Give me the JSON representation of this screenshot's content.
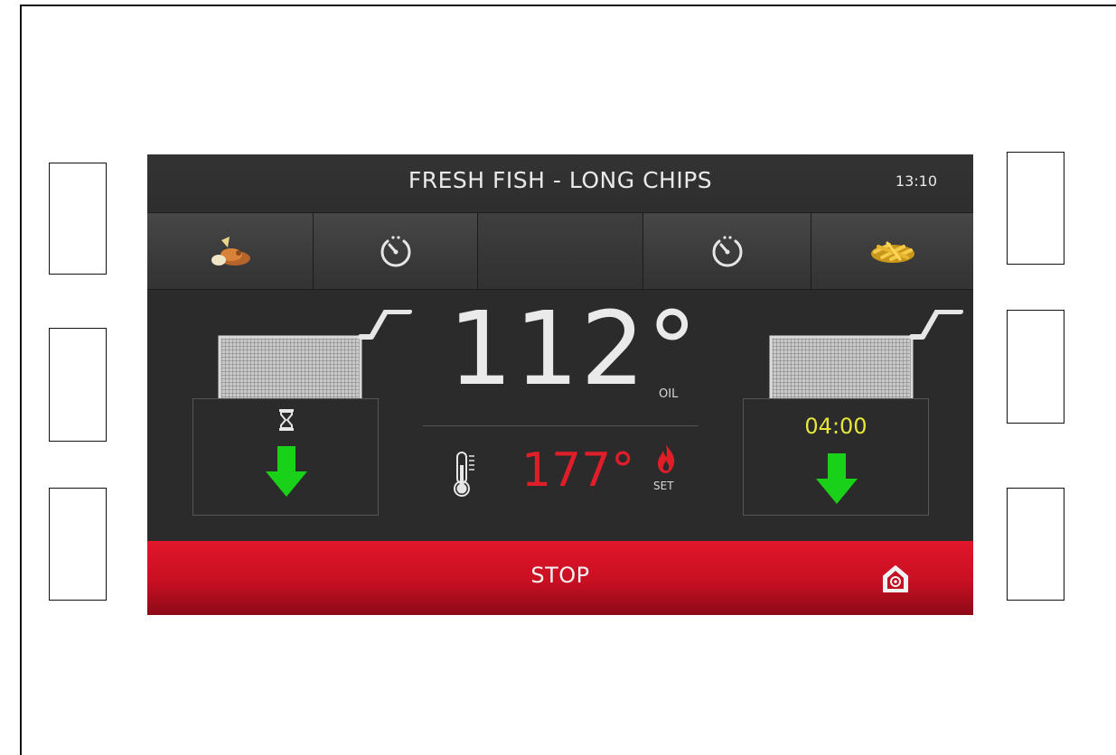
{
  "header": {
    "title": "FRESH FISH - LONG CHIPS",
    "clock": "13:10"
  },
  "tabs": [
    {
      "icon": "fish-food-icon"
    },
    {
      "icon": "stopwatch-icon"
    },
    {
      "icon": "blank"
    },
    {
      "icon": "stopwatch-icon"
    },
    {
      "icon": "fries-icon"
    }
  ],
  "left_basket": {
    "status_icon": "hourglass-icon",
    "action_icon": "down-arrow-icon"
  },
  "right_basket": {
    "timer": "04:00",
    "action_icon": "down-arrow-icon"
  },
  "oil": {
    "temperature": "112°",
    "label": "OIL"
  },
  "setpoint": {
    "temperature": "177°",
    "label": "SET"
  },
  "footer": {
    "stop_label": "STOP",
    "home_icon": "home-icon"
  },
  "colors": {
    "accent_red": "#e01e2a",
    "timer_yellow": "#e6e63a",
    "arrow_green": "#19d119",
    "screen_bg": "#2b2b2b"
  }
}
